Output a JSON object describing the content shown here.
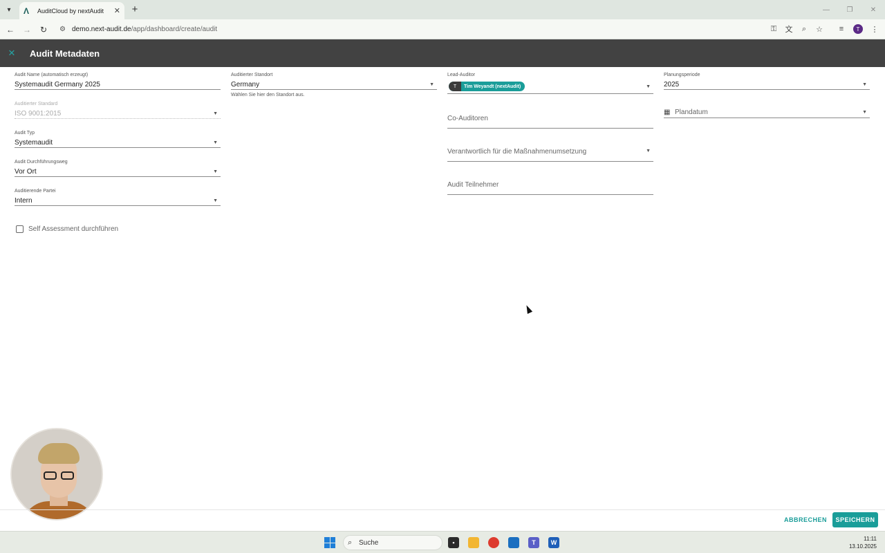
{
  "browser": {
    "tab_title": "AuditCloud by nextAudit",
    "url_host": "demo.next-audit.de",
    "url_path": "/app/dashboard/create/audit",
    "profile_initial": "T",
    "window_controls": [
      "minimize-icon",
      "restore-icon",
      "close-icon"
    ]
  },
  "header": {
    "title": "Audit Metadaten"
  },
  "form": {
    "audit_name": {
      "label": "Audit Name (automatisch erzeugt)",
      "value": "Systemaudit Germany 2025"
    },
    "standard": {
      "label": "Auditierter Standard",
      "value": "ISO 9001:2015"
    },
    "audit_typ": {
      "label": "Audit Typ",
      "value": "Systemaudit"
    },
    "durchfuehrungsweg": {
      "label": "Audit Durchführungsweg",
      "value": "Vor Ort"
    },
    "partei": {
      "label": "Auditierende Partei",
      "value": "Intern"
    },
    "self_assessment": {
      "label": "Self Assessment durchführen",
      "checked": false
    },
    "standort": {
      "label": "Auditierter Standort",
      "value": "Germany",
      "hint": "Wählen Sie hier den Standort aus."
    },
    "lead_auditor": {
      "label": "Lead-Auditor",
      "chip_initial": "T",
      "chip_label": "Tim Weyandt (nextAudit)"
    },
    "co_auditoren": {
      "placeholder": "Co-Auditoren"
    },
    "verantwortlich": {
      "placeholder": "Verantwortlich für die Maßnahmenumsetzung"
    },
    "teilnehmer": {
      "placeholder": "Audit Teilnehmer"
    },
    "planungsperiode": {
      "label": "Planungsperiode",
      "value": "2025"
    },
    "plandatum": {
      "placeholder": "Plandatum"
    }
  },
  "footer": {
    "cancel_label": "ABBRECHEN",
    "save_label": "SPEICHERN"
  },
  "taskbar": {
    "search_label": "Suche",
    "time": "11:11",
    "date": "13.10.2025"
  },
  "colors": {
    "accent": "#1a9d99",
    "header_bg": "#424242",
    "profile": "#5b2a86"
  }
}
